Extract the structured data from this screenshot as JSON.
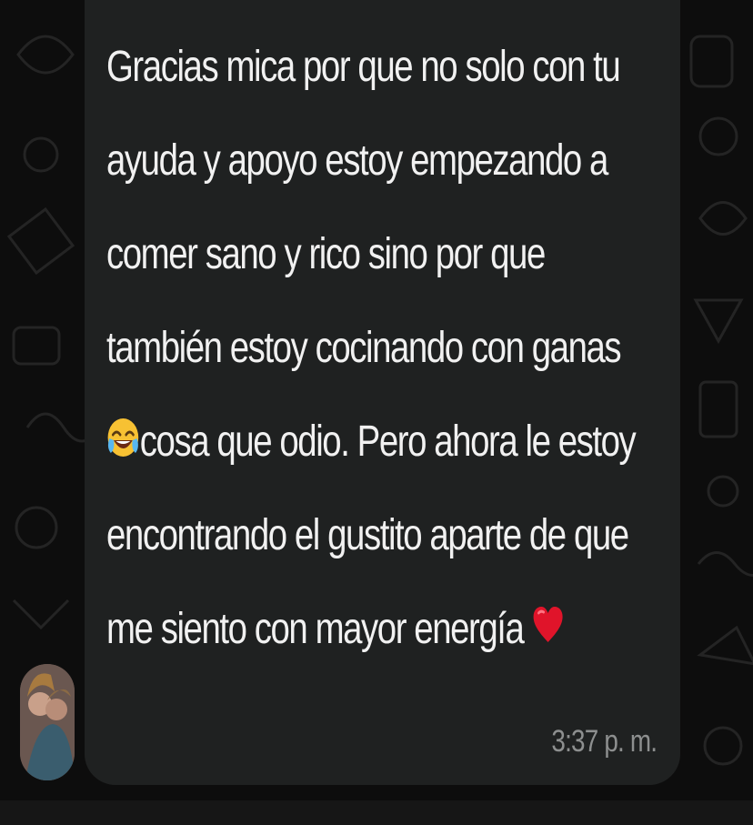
{
  "chat": {
    "message_lines": [
      "Gracias mica por que no solo con tu",
      "ayuda y apoyo estoy empezando a",
      "comer sano y rico sino por que",
      "también estoy cocinando con ganas",
      "cosa que odio. Pero ahora le estoy",
      "encontrando el gustito aparte de que",
      "me siento con mayor energía"
    ],
    "timestamp": "3:37 p. m.",
    "inline_icons": [
      "face-with-tears-of-joy-emoji",
      "red-heart-emoji"
    ],
    "colors": {
      "background": "#0d0d0d",
      "bubble": "#1f2121",
      "text": "#f1f1f1",
      "timestamp": "#8d8f8f"
    }
  }
}
